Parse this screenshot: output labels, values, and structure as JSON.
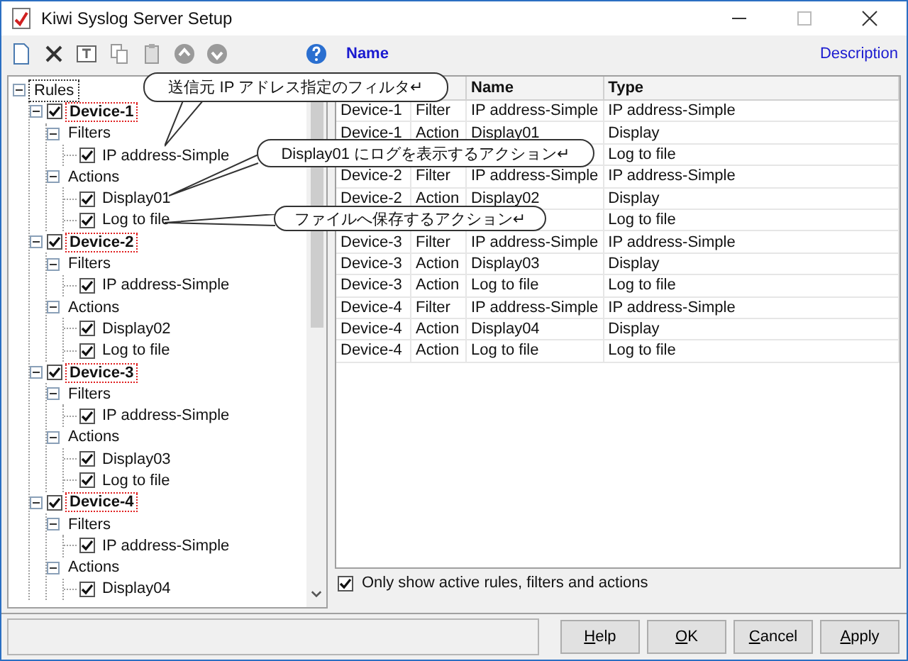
{
  "window": {
    "title": "Kiwi Syslog Server Setup"
  },
  "toolbar": {
    "name_label": "Name",
    "description_label": "Description"
  },
  "tree": {
    "label": "Rules",
    "expanded": true,
    "children": [
      {
        "kind": "rule",
        "label": "Device-1",
        "checked": true,
        "highlighted": true,
        "expanded": true,
        "children": [
          {
            "kind": "group",
            "label": "Filters",
            "expanded": true,
            "children": [
              {
                "kind": "entry",
                "label": "IP address-Simple",
                "checked": true
              }
            ]
          },
          {
            "kind": "group",
            "label": "Actions",
            "expanded": true,
            "children": [
              {
                "kind": "entry",
                "label": "Display01",
                "checked": true
              },
              {
                "kind": "entry",
                "label": "Log to file",
                "checked": true
              }
            ]
          }
        ]
      },
      {
        "kind": "rule",
        "label": "Device-2",
        "checked": true,
        "highlighted": true,
        "expanded": true,
        "children": [
          {
            "kind": "group",
            "label": "Filters",
            "expanded": true,
            "children": [
              {
                "kind": "entry",
                "label": "IP address-Simple",
                "checked": true
              }
            ]
          },
          {
            "kind": "group",
            "label": "Actions",
            "expanded": true,
            "children": [
              {
                "kind": "entry",
                "label": "Display02",
                "checked": true
              },
              {
                "kind": "entry",
                "label": "Log to file",
                "checked": true
              }
            ]
          }
        ]
      },
      {
        "kind": "rule",
        "label": "Device-3",
        "checked": true,
        "highlighted": true,
        "expanded": true,
        "children": [
          {
            "kind": "group",
            "label": "Filters",
            "expanded": true,
            "children": [
              {
                "kind": "entry",
                "label": "IP address-Simple",
                "checked": true
              }
            ]
          },
          {
            "kind": "group",
            "label": "Actions",
            "expanded": true,
            "children": [
              {
                "kind": "entry",
                "label": "Display03",
                "checked": true
              },
              {
                "kind": "entry",
                "label": "Log to file",
                "checked": true
              }
            ]
          }
        ]
      },
      {
        "kind": "rule",
        "label": "Device-4",
        "checked": true,
        "highlighted": true,
        "expanded": true,
        "children": [
          {
            "kind": "group",
            "label": "Filters",
            "expanded": true,
            "children": [
              {
                "kind": "entry",
                "label": "IP address-Simple",
                "checked": true
              }
            ]
          },
          {
            "kind": "group",
            "label": "Actions",
            "expanded": true,
            "children": [
              {
                "kind": "entry",
                "label": "Display04",
                "checked": true
              }
            ]
          }
        ]
      }
    ]
  },
  "table": {
    "columns": [
      {},
      {},
      {
        "label": "Name"
      },
      {
        "label": "Type"
      }
    ],
    "rows": [
      {
        "cells": [
          "Device-1",
          "Filter",
          "IP address-Simple",
          "IP address-Simple"
        ]
      },
      {
        "cells": [
          "Device-1",
          "Action",
          "Display01",
          "Display"
        ]
      },
      {
        "cells": [
          null,
          null,
          null,
          "Log to file"
        ]
      },
      {
        "cells": [
          "Device-2",
          "Filter",
          "IP address-Simple",
          "IP address-Simple"
        ]
      },
      {
        "cells": [
          "Device-2",
          "Action",
          "Display02",
          "Display"
        ]
      },
      {
        "cells": [
          null,
          null,
          null,
          "Log to file"
        ]
      },
      {
        "cells": [
          "Device-3",
          "Filter",
          "IP address-Simple",
          "IP address-Simple"
        ]
      },
      {
        "cells": [
          "Device-3",
          "Action",
          "Display03",
          "Display"
        ]
      },
      {
        "cells": [
          "Device-3",
          "Action",
          "Log to file",
          "Log to file"
        ]
      },
      {
        "cells": [
          "Device-4",
          "Filter",
          "IP address-Simple",
          "IP address-Simple"
        ]
      },
      {
        "cells": [
          "Device-4",
          "Action",
          "Display04",
          "Display"
        ]
      },
      {
        "cells": [
          "Device-4",
          "Action",
          "Log to file",
          "Log to file"
        ]
      }
    ]
  },
  "active_only": {
    "label": "Only show active rules, filters and actions",
    "checked": true
  },
  "buttons": [
    "Help",
    "OK",
    "Cancel",
    "Apply"
  ],
  "callouts": [
    {
      "text": "送信元 IP アドレス指定のフィルタ↵"
    },
    {
      "text": "Display01 にログを表示するアクション↵"
    },
    {
      "text": "ファイルへ保存するアクション↵"
    }
  ]
}
